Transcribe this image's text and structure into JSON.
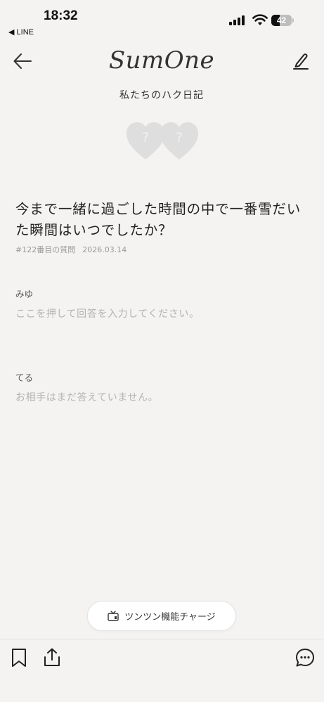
{
  "status_bar": {
    "time": "18:32",
    "back_app": "◀ LINE",
    "battery_level": "42",
    "battery_fraction": 0.42
  },
  "nav": {
    "logo": "SumOne",
    "subtitle": "私たちのハク日記",
    "back_icon": "arrow-left-icon",
    "edit_icon": "pencil-icon"
  },
  "hearts": {
    "left_mark": "?",
    "right_mark": "?",
    "color": "#dedede"
  },
  "question": {
    "text": "今まで一緒に過ごした時間の中で一番雪だいた瞬間はいつでしたか？",
    "number": "#122番目の質問",
    "date": "2026.03.14"
  },
  "answers": [
    {
      "name": "みゆ",
      "text": "ここを押して回答を入力してください。"
    },
    {
      "name": "てる",
      "text": "お相手はまだ答えていません。"
    }
  ],
  "charge_button": {
    "label": "ツンツン機能チャージ",
    "icon": "tv-icon"
  },
  "bottom_bar": {
    "bookmark_icon": "bookmark-icon",
    "share_icon": "share-icon",
    "comment_icon": "comment-icon"
  }
}
